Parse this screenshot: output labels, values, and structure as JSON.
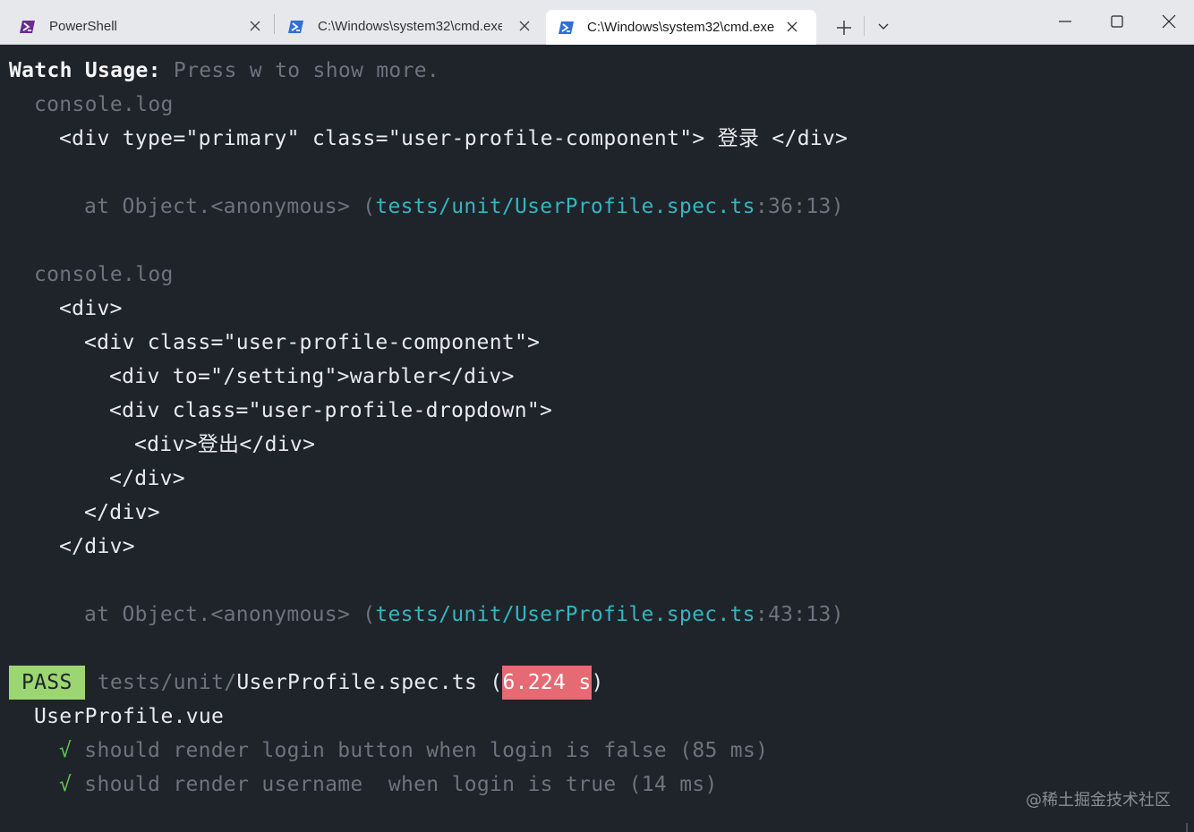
{
  "tabs": [
    {
      "title": "PowerShell",
      "icon": "powershell-icon"
    },
    {
      "title": "C:\\Windows\\system32\\cmd.exe",
      "icon": "powershell-icon"
    },
    {
      "title": "C:\\Windows\\system32\\cmd.exe",
      "icon": "powershell-icon",
      "active": true
    }
  ],
  "terminal": {
    "watch_label": "Watch Usage:",
    "watch_hint": " Press w to show more.",
    "log1": {
      "label": "console.log",
      "content": "<div type=\"primary\" class=\"user-profile-component\"> 登录 </div>",
      "at_prefix": "at Object.<anonymous> (",
      "file": "tests/unit/UserProfile.spec.ts",
      "loc": ":36:13)"
    },
    "log2": {
      "label": "console.log",
      "lines": [
        "<div>",
        "<div class=\"user-profile-component\">",
        "<div to=\"/setting\">warbler</div>",
        "<div class=\"user-profile-dropdown\">",
        "<div>登出</div>",
        "</div>",
        "</div>",
        "</div>"
      ],
      "at_prefix": "at Object.<anonymous> (",
      "file": "tests/unit/UserProfile.spec.ts",
      "loc": ":43:13)"
    },
    "result": {
      "badge": "PASS",
      "path_dir": "tests/unit/",
      "path_file": "UserProfile.spec.ts",
      "open_paren": " (",
      "time": "6.224 s",
      "close_paren": ")"
    },
    "suite": "UserProfile.vue",
    "tests": [
      {
        "check": "√",
        "text": " should render login button when login is false (85 ms)"
      },
      {
        "check": "√",
        "text": " should render username  when login is true (14 ms)"
      }
    ]
  },
  "watermark": "@稀土掘金技术社区",
  "colors": {
    "terminal_bg": "#1f232a",
    "pass": "#9bd672",
    "time": "#e56a73",
    "path": "#34b5c0"
  }
}
